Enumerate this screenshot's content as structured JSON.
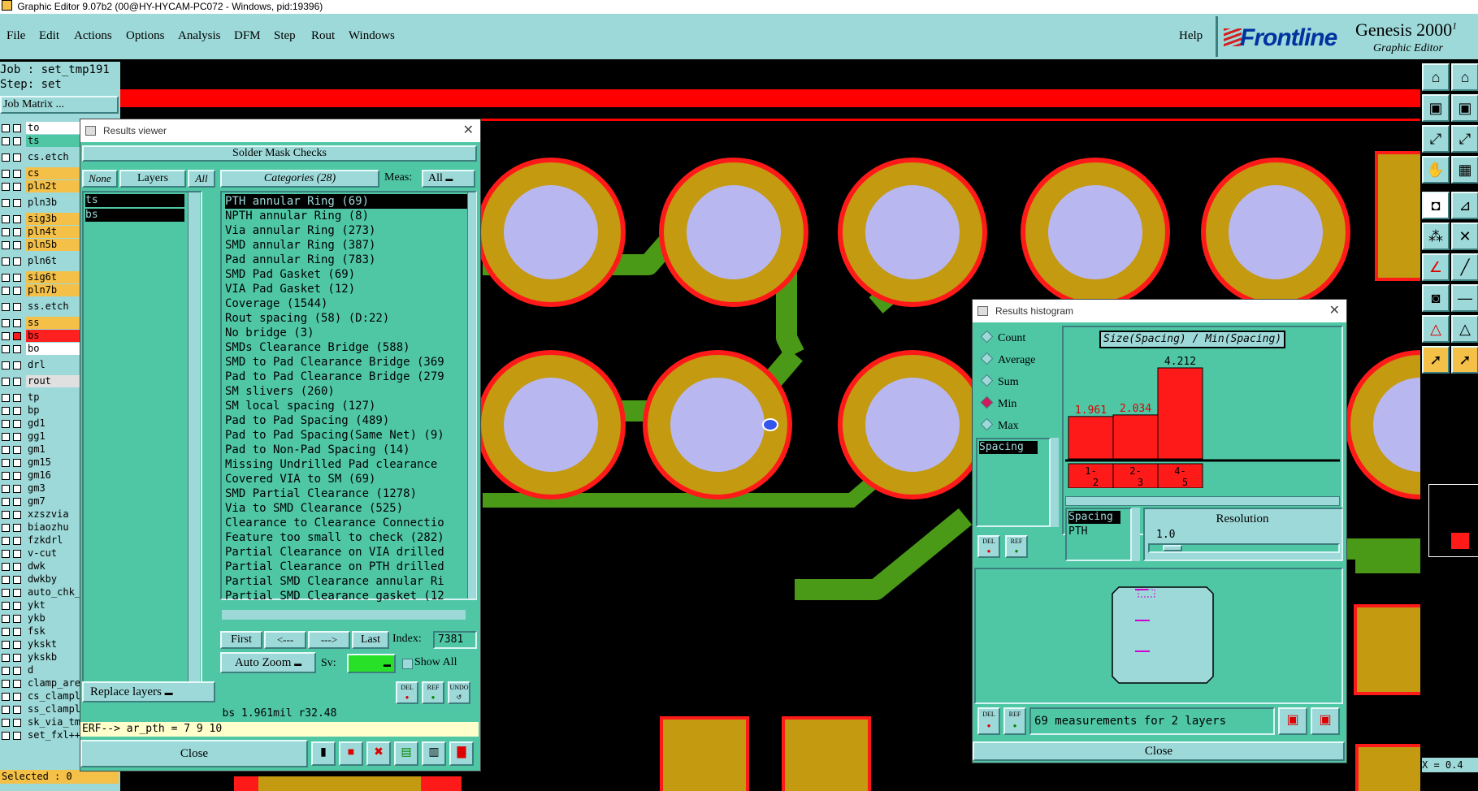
{
  "window_title": "Graphic Editor 9.07b2 (00@HY-HYCAM-PC072 - Windows, pid:19396)",
  "menu": [
    "File",
    "Edit",
    "Actions",
    "Options",
    "Analysis",
    "DFM",
    "Step",
    "Rout",
    "Windows"
  ],
  "help_label": "Help",
  "brand": {
    "logo": "Frontline",
    "product": "Genesis 2000",
    "product_sup": "1",
    "subtitle": "Graphic Editor"
  },
  "job": {
    "job_label": "Job : set_tmp191",
    "step_label": "Step: set",
    "matrix_button": "Job Matrix ..."
  },
  "layers": [
    {
      "name": "to",
      "color": "#ffffff"
    },
    {
      "name": "ts",
      "color": "#4fc7a5"
    },
    {
      "name": "cs.etch",
      "color": "#9ed9d9"
    },
    {
      "name": "cs",
      "color": "#f4c048"
    },
    {
      "name": "pln2t",
      "color": "#f4c048"
    },
    {
      "name": "pln3b",
      "color": "#9ed9d9"
    },
    {
      "name": "sig3b",
      "color": "#f4c048"
    },
    {
      "name": "pln4t",
      "color": "#f4c048"
    },
    {
      "name": "pln5b",
      "color": "#f4c048"
    },
    {
      "name": "pln6t",
      "color": "#9ed9d9"
    },
    {
      "name": "sig6t",
      "color": "#f4c048"
    },
    {
      "name": "pln7b",
      "color": "#f4c048"
    },
    {
      "name": "ss.etch",
      "color": "#9ed9d9"
    },
    {
      "name": "ss",
      "color": "#f4c048"
    },
    {
      "name": "bs",
      "color": "#ff2020"
    },
    {
      "name": "bo",
      "color": "#ffffff"
    },
    {
      "name": "drl",
      "color": "#9ed9d9"
    },
    {
      "name": "rout",
      "color": "#e0e0e0"
    },
    {
      "name": "tp",
      "color": "#9ed9d9"
    },
    {
      "name": "bp",
      "color": "#9ed9d9"
    },
    {
      "name": "gd1",
      "color": "#9ed9d9"
    },
    {
      "name": "gg1",
      "color": "#9ed9d9"
    },
    {
      "name": "gm1",
      "color": "#9ed9d9"
    },
    {
      "name": "gm15",
      "color": "#9ed9d9"
    },
    {
      "name": "gm16",
      "color": "#9ed9d9"
    },
    {
      "name": "gm3",
      "color": "#9ed9d9"
    },
    {
      "name": "gm7",
      "color": "#9ed9d9"
    },
    {
      "name": "xzszvia",
      "color": "#9ed9d9"
    },
    {
      "name": "biaozhu",
      "color": "#9ed9d9"
    },
    {
      "name": "fzkdrl",
      "color": "#9ed9d9"
    },
    {
      "name": "v-cut",
      "color": "#9ed9d9"
    },
    {
      "name": "dwk",
      "color": "#9ed9d9"
    },
    {
      "name": "dwkby",
      "color": "#9ed9d9"
    },
    {
      "name": "auto_chk_",
      "color": "#9ed9d9"
    },
    {
      "name": "ykt",
      "color": "#9ed9d9"
    },
    {
      "name": "ykb",
      "color": "#9ed9d9"
    },
    {
      "name": "fsk",
      "color": "#9ed9d9"
    },
    {
      "name": "ykskt",
      "color": "#9ed9d9"
    },
    {
      "name": "ykskb",
      "color": "#9ed9d9"
    },
    {
      "name": "d",
      "color": "#9ed9d9"
    },
    {
      "name": "clamp_are",
      "color": "#9ed9d9"
    },
    {
      "name": "cs_clampl",
      "color": "#9ed9d9"
    },
    {
      "name": "ss_clampl",
      "color": "#9ed9d9"
    },
    {
      "name": "sk_via_tm",
      "color": "#9ed9d9"
    },
    {
      "name": "set_fxl++",
      "color": "#9ed9d9"
    }
  ],
  "selected_label": "Selected : 0",
  "results_viewer": {
    "title": "Results viewer",
    "heading": "Solder Mask Checks",
    "none_btn": "None",
    "layers_btn": "Layers",
    "all_btn": "All",
    "layer_list": [
      "ts",
      "bs"
    ],
    "categories_btn": "Categories (28)",
    "meas_label": "Meas:",
    "meas_value": "All",
    "categories": [
      "PTH annular Ring (69)",
      "NPTH annular Ring (8)",
      "Via annular Ring (273)",
      "SMD annular Ring (387)",
      "Pad annular Ring (783)",
      "SMD Pad Gasket (69)",
      "VIA Pad Gasket (12)",
      "Coverage (1544)",
      "Rout spacing (58)        (D:22)",
      "No bridge (3)",
      "SMDs Clearance Bridge (588)",
      "SMD to Pad Clearance Bridge (369",
      "Pad to Pad Clearance Bridge (279",
      "SM slivers (260)",
      "SM local spacing (127)",
      "Pad to Pad Spacing (489)",
      "Pad to Pad Spacing(Same Net) (9)",
      "Pad to Non-Pad Spacing (14)",
      "Missing Undrilled Pad clearance",
      "Covered VIA to SM (69)",
      "SMD Partial Clearance (1278)",
      "Via to SMD Clearance (525)",
      "Clearance to Clearance Connectio",
      "Feature too small to check (282)",
      "Partial Clearance on VIA drilled",
      "Partial Clearance on PTH drilled",
      "Partial SMD Clearance annular Ri",
      "Partial SMD Clearance gasket (12"
    ],
    "nav": {
      "first": "First",
      "prev": "<---",
      "next": "--->",
      "last": "Last",
      "index_label": "Index:",
      "index_value": "7381"
    },
    "auto_zoom": "Auto Zoom",
    "sv_label": "Sv:",
    "show_all": "Show All",
    "replace_layers": "Replace layers",
    "del": "DEL",
    "ref": "REF",
    "undo": "UNDO",
    "status": "bs 1.961mil  r32.48",
    "erf": "ERF--> ar_pth = 7 9 10",
    "close": "Close"
  },
  "histogram": {
    "title": "Results histogram",
    "modes": [
      "Count",
      "Average",
      "Sum",
      "Min",
      "Max"
    ],
    "selected_mode": "Min",
    "chart_title": "Size(Spacing) / Min(Spacing)",
    "bars": [
      {
        "label_top": "1-",
        "label_bot": "2",
        "value": 1.961
      },
      {
        "label_top": "2-",
        "label_bot": "3",
        "value": 2.034
      },
      {
        "label_top": "4-",
        "label_bot": "5",
        "value": 4.212
      }
    ],
    "bar_labels": [
      "1.961",
      "2.034",
      "4.212"
    ],
    "list_item": "Spacing",
    "sub_list": [
      "Spacing",
      "PTH"
    ],
    "resolution_label": "Resolution",
    "resolution_value": "1.0",
    "del": "DEL",
    "ref": "REF",
    "footer_text": "69 measurements for 2 layers",
    "close": "Close"
  },
  "coords": "X = 0.4"
}
